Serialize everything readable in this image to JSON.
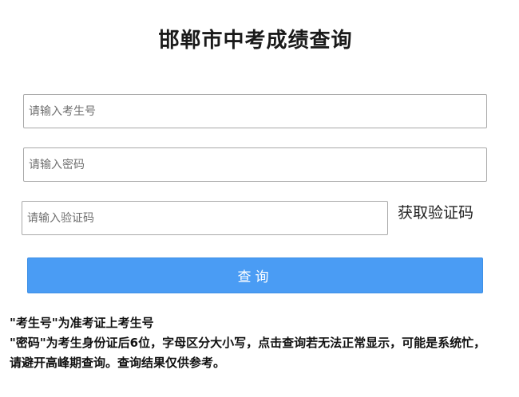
{
  "title": "邯郸市中考成绩查询",
  "form": {
    "student_id_placeholder": "请输入考生号",
    "password_placeholder": "请输入密码",
    "captcha_placeholder": "请输入验证码",
    "get_captcha_label": "获取验证码",
    "submit_label": "查询"
  },
  "notes": [
    "\"考生号\"为准考证上考生号",
    "\"密码\"为考生身份证后6位，字母区分大小写，点击查询若无法正常显示，可能是系统忙，请避开高峰期查询。查询结果仅供参考。"
  ],
  "colors": {
    "button_bg": "#4a9cf4",
    "button_text": "#ffffff"
  }
}
